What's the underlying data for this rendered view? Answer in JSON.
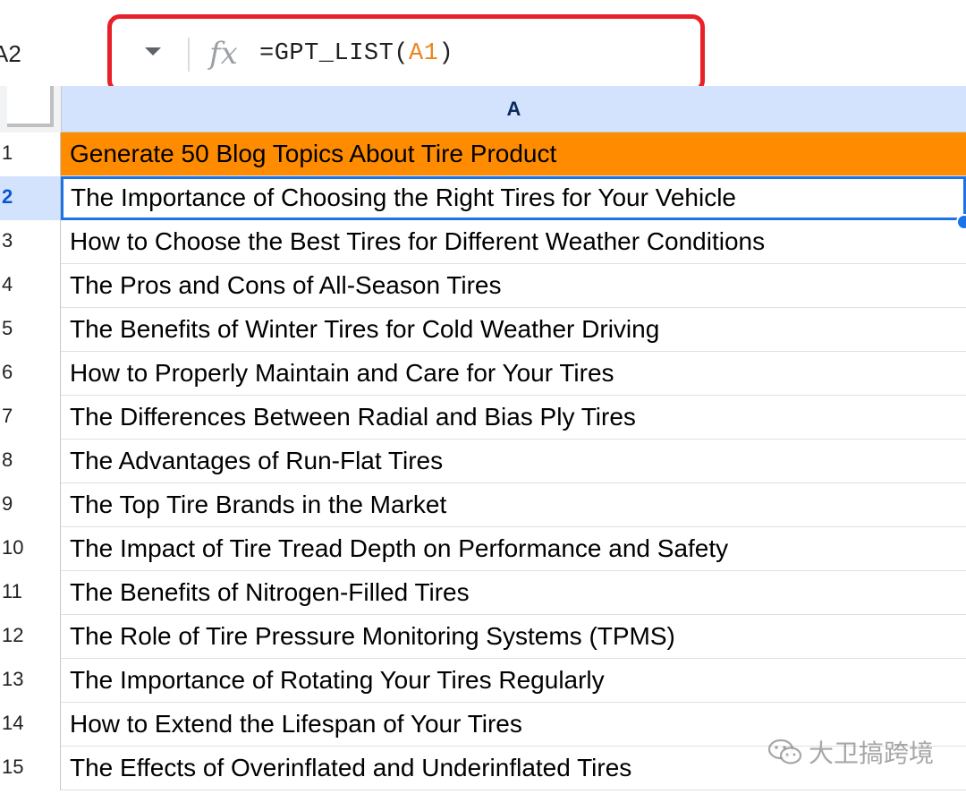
{
  "formula_bar": {
    "name_box": "A2",
    "fx_label": "fx",
    "formula_prefix": "=GPT_LIST(",
    "formula_ref": "A1",
    "formula_suffix": ")"
  },
  "column_header": "A",
  "rows": [
    {
      "num": "1",
      "text": "Generate 50 Blog Topics About Tire Product"
    },
    {
      "num": "2",
      "text": "The Importance of Choosing the Right Tires for Your Vehicle"
    },
    {
      "num": "3",
      "text": "How to Choose the Best Tires for Different Weather Conditions"
    },
    {
      "num": "4",
      "text": "The Pros and Cons of All-Season Tires"
    },
    {
      "num": "5",
      "text": "The Benefits of Winter Tires for Cold Weather Driving"
    },
    {
      "num": "6",
      "text": "How to Properly Maintain and Care for Your Tires"
    },
    {
      "num": "7",
      "text": "The Differences Between Radial and Bias Ply Tires"
    },
    {
      "num": "8",
      "text": "The Advantages of Run-Flat Tires"
    },
    {
      "num": "9",
      "text": "The Top Tire Brands in the Market"
    },
    {
      "num": "10",
      "text": "The Impact of Tire Tread Depth on Performance and Safety"
    },
    {
      "num": "11",
      "text": "The Benefits of Nitrogen-Filled Tires"
    },
    {
      "num": "12",
      "text": "The Role of Tire Pressure Monitoring Systems (TPMS)"
    },
    {
      "num": "13",
      "text": "The Importance of Rotating Your Tires Regularly"
    },
    {
      "num": "14",
      "text": "How to Extend the Lifespan of Your Tires"
    },
    {
      "num": "15",
      "text": "The Effects of Overinflated and Underinflated Tires"
    }
  ],
  "watermark": "大卫搞跨境",
  "colors": {
    "header_fill": "#ff8c00",
    "selection": "#1a73e8",
    "highlight_box": "#e8202a",
    "column_header_bg": "#d3e3fd"
  },
  "icons": [
    "dropdown-caret-icon",
    "fx-icon",
    "wechat-icon"
  ]
}
